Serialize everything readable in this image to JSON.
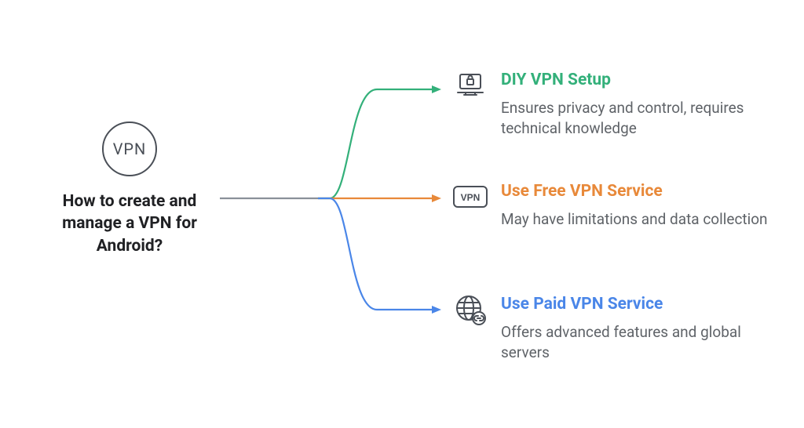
{
  "source": {
    "icon_label": "VPN",
    "question": "How to create and manage a VPN for Android?"
  },
  "options": [
    {
      "title": "DIY VPN Setup",
      "description": "Ensures privacy and control, requires technical knowledge",
      "color": "#33b07a"
    },
    {
      "title": "Use Free VPN Service",
      "description": "May have limitations and data collection",
      "color": "#e8893a"
    },
    {
      "title": "Use Paid VPN Service",
      "description": "Offers advanced features and global servers",
      "color": "#4a86e8"
    }
  ]
}
